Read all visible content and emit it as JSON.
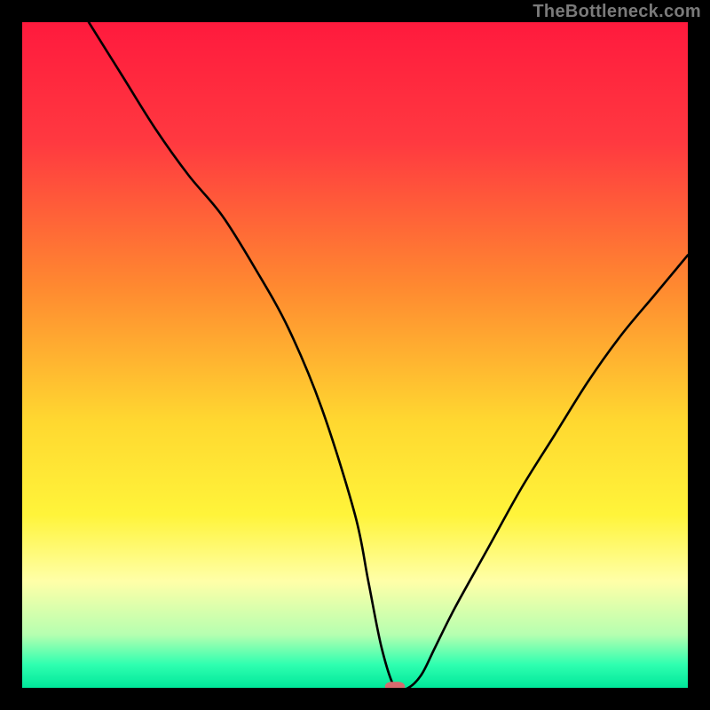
{
  "watermark": "TheBottleneck.com",
  "chart_data": {
    "type": "line",
    "title": "",
    "xlabel": "",
    "ylabel": "",
    "xlim": [
      0,
      100
    ],
    "ylim": [
      0,
      100
    ],
    "grid": false,
    "background_gradient": {
      "stops": [
        {
          "offset": 0.0,
          "color": "#ff1a3d"
        },
        {
          "offset": 0.18,
          "color": "#ff3940"
        },
        {
          "offset": 0.4,
          "color": "#ff8a30"
        },
        {
          "offset": 0.6,
          "color": "#ffd830"
        },
        {
          "offset": 0.74,
          "color": "#fff43a"
        },
        {
          "offset": 0.84,
          "color": "#ffffa8"
        },
        {
          "offset": 0.92,
          "color": "#b6ffb0"
        },
        {
          "offset": 0.965,
          "color": "#2fffb0"
        },
        {
          "offset": 1.0,
          "color": "#00e79a"
        }
      ]
    },
    "series": [
      {
        "name": "bottleneck-curve",
        "x": [
          10,
          15,
          20,
          25,
          30,
          35,
          40,
          45,
          50,
          52,
          54,
          56,
          58,
          60,
          62,
          65,
          70,
          75,
          80,
          85,
          90,
          95,
          100
        ],
        "y": [
          100,
          92,
          84,
          77,
          71,
          63,
          54,
          42,
          26,
          16,
          6,
          0,
          0,
          2,
          6,
          12,
          21,
          30,
          38,
          46,
          53,
          59,
          65
        ]
      }
    ],
    "marker": {
      "name": "optimal-point",
      "x": 56,
      "y": 0,
      "color": "#d76a6f"
    }
  }
}
